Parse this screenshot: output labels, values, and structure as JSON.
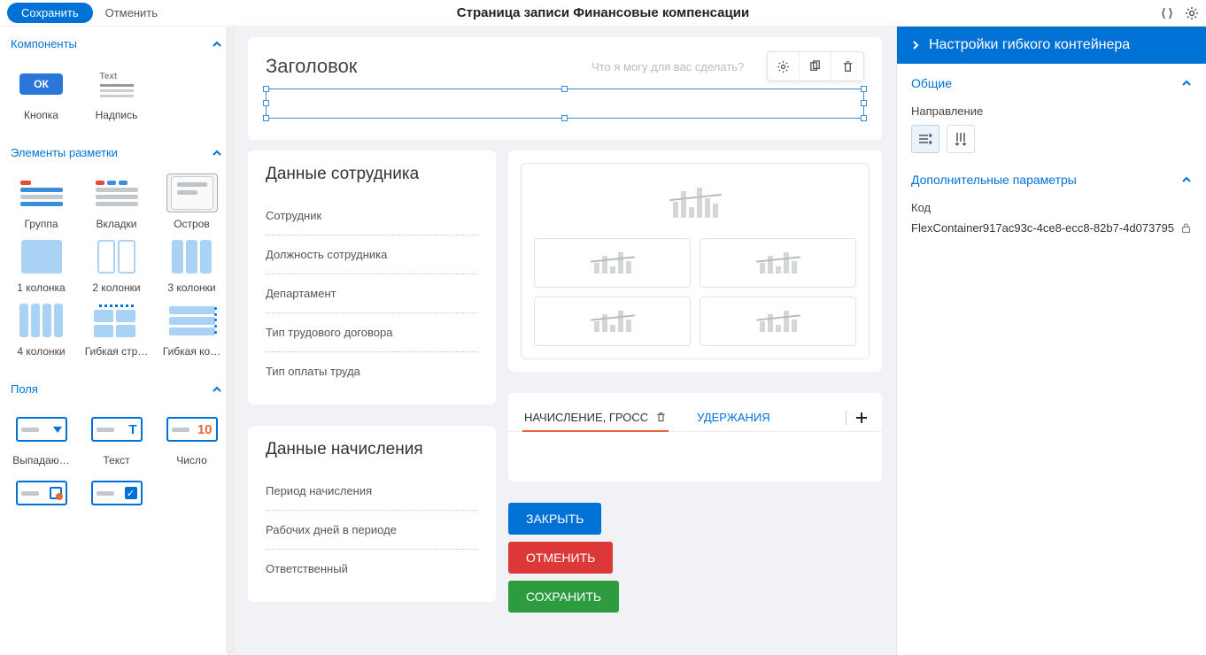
{
  "topbar": {
    "save": "Сохранить",
    "cancel": "Отменить",
    "title": "Страница записи Финансовые компенсации"
  },
  "left": {
    "sections": {
      "components": "Компоненты",
      "layout": "Элементы разметки",
      "fields": "Поля"
    },
    "component_items": {
      "ok": "ОК",
      "button": "Кнопка",
      "label_text": "Text",
      "label": "Надпись"
    },
    "layout_items": {
      "group": "Группа",
      "tabs": "Вкладки",
      "island": "Остров",
      "col1": "1 колонка",
      "col2": "2 колонки",
      "col3": "3 колонки",
      "col4": "4 колонки",
      "flexrow": "Гибкая стр…",
      "flexcol": "Гибкая ко…"
    },
    "field_items": {
      "dropdown": "Выпадаю…",
      "text": "Текст",
      "number": "Число",
      "number_val": "10",
      "text_t": "T"
    }
  },
  "canvas": {
    "header_title": "Заголовок",
    "ask_placeholder": "Что я могу для вас сделать?",
    "employee_card": {
      "title": "Данные сотрудника",
      "fields": [
        "Сотрудник",
        "Должность сотрудника",
        "Департамент",
        "Тип трудового договора",
        "Тип оплаты труда"
      ]
    },
    "accrual_card": {
      "title": "Данные начисления",
      "fields": [
        "Период начисления",
        "Рабочих дней в периоде",
        "Ответственный"
      ]
    },
    "tabs": {
      "tab1": "НАЧИСЛЕНИЕ, ГРОСС",
      "tab2": "УДЕРЖАНИЯ"
    },
    "buttons": {
      "close": "ЗАКРЫТЬ",
      "cancel": "ОТМЕНИТЬ",
      "save": "СОХРАНИТЬ"
    }
  },
  "right": {
    "title": "Настройки гибкого контейнера",
    "section_general": "Общие",
    "direction_label": "Направление",
    "section_advanced": "Дополнительные параметры",
    "code_label": "Код",
    "code_value": "FlexContainer917ac93c-4ce8-ecc8-82b7-4d073795"
  }
}
